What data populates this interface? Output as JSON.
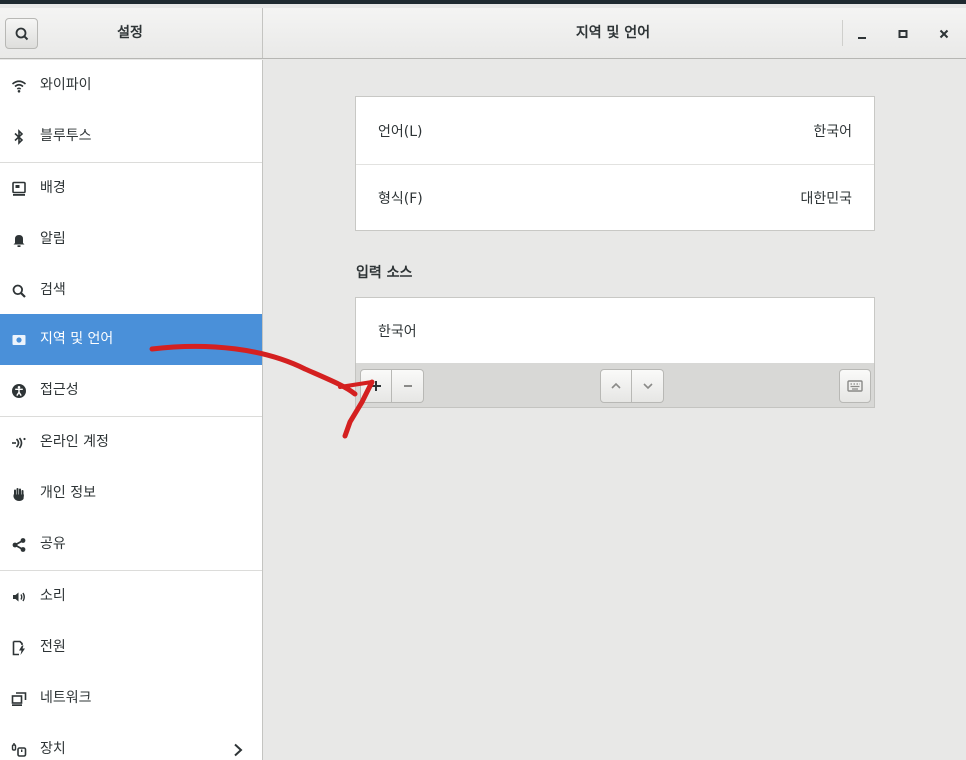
{
  "header": {
    "sidebar_title": "설정",
    "main_title": "지역 및 언어"
  },
  "sidebar": {
    "items": [
      {
        "label": "와이파이",
        "icon": "wifi-icon"
      },
      {
        "label": "블루투스",
        "icon": "bluetooth-icon"
      },
      {
        "label": "배경",
        "icon": "background-icon"
      },
      {
        "label": "알림",
        "icon": "bell-icon"
      },
      {
        "label": "검색",
        "icon": "search-icon"
      },
      {
        "label": "지역 및 언어",
        "icon": "region-flag-icon",
        "active": true
      },
      {
        "label": "접근성",
        "icon": "accessibility-icon"
      },
      {
        "label": "온라인 계정",
        "icon": "online-accounts-icon"
      },
      {
        "label": "개인 정보",
        "icon": "privacy-hand-icon"
      },
      {
        "label": "공유",
        "icon": "share-icon"
      },
      {
        "label": "소리",
        "icon": "speaker-icon"
      },
      {
        "label": "전원",
        "icon": "power-icon"
      },
      {
        "label": "네트워크",
        "icon": "network-icon"
      },
      {
        "label": "장치",
        "icon": "devices-icon"
      }
    ]
  },
  "main": {
    "language_label": "언어(L)",
    "language_value": "한국어",
    "formats_label": "형식(F)",
    "formats_value": "대한민국",
    "input_sources_heading": "입력 소스",
    "input_sources": [
      "한국어"
    ]
  },
  "colors": {
    "accent": "#4a90d9",
    "annotation": "#d42020"
  }
}
